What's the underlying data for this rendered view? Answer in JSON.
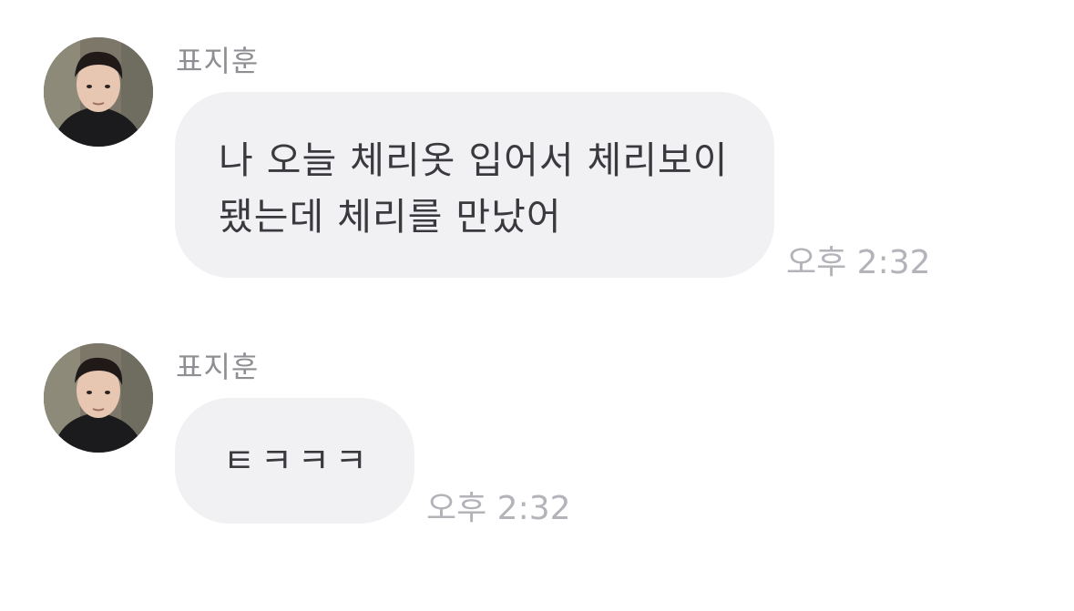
{
  "messages": [
    {
      "sender": "표지훈",
      "avatar_icon": "profile-photo",
      "text": "나 오늘 체리옷 입어서 체리보이 됐는데 체리를 만났어",
      "time": "오후 2:32"
    },
    {
      "sender": "표지훈",
      "avatar_icon": "profile-photo",
      "text": "ㅌㅋㅋㅋ",
      "time": "오후 2:32"
    }
  ],
  "colors": {
    "bubble_background": "#f1f1f4",
    "message_text": "#3a3a3e",
    "sender_name": "#8e8e93",
    "timestamp": "#b3b3ba"
  }
}
